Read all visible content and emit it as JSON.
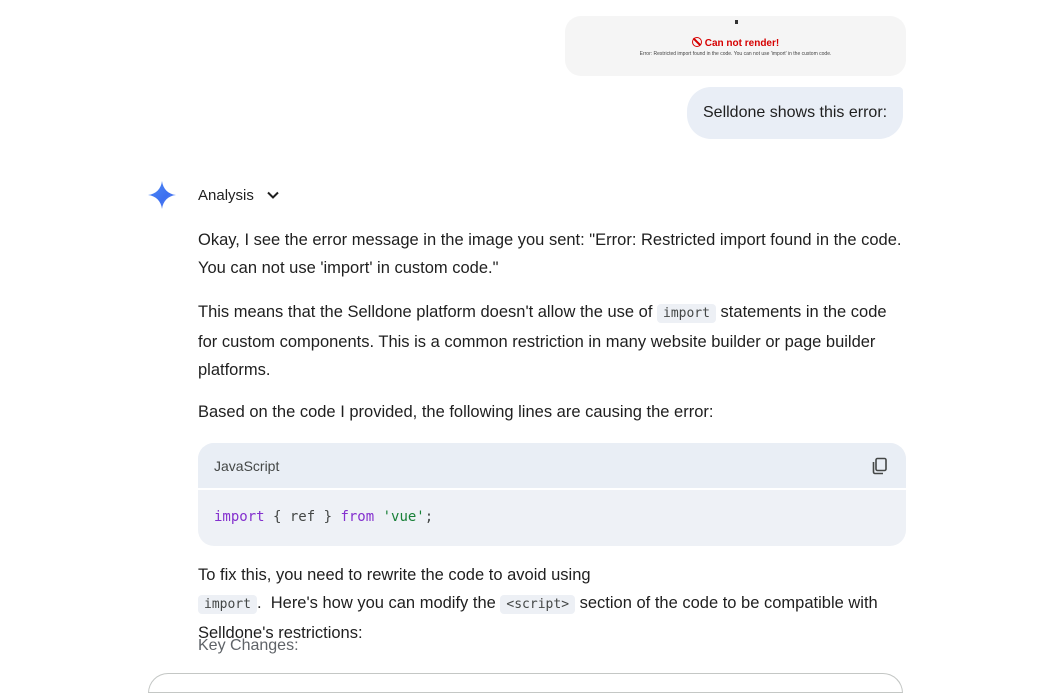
{
  "attachment": {
    "title": "Can not render!",
    "subtitle": "Error: Restricted import found in the code. You can not use 'import' in the custom code."
  },
  "user_message": "Selldone shows this error:",
  "response": {
    "analysis_label": "Analysis",
    "p1": "Okay, I see the error message in the image you sent: \"Error: Restricted import found in the code. You can not use 'import' in custom code.\"",
    "p2_before": "This means that the Selldone platform doesn't allow the use of ",
    "p2_code": "import",
    "p2_after": " statements in the code for custom components. This is a common restriction in many website builder or page builder platforms.",
    "p3": "Based on the code I provided, the following lines are causing the error:",
    "code_block": {
      "language": "JavaScript",
      "tok_import": "import",
      "tok_braces": " { ref } ",
      "tok_from": "from",
      "tok_space": " ",
      "tok_string": "'vue'",
      "tok_semi": ";"
    },
    "p4_a": "To fix this, you need to rewrite the code to avoid using ",
    "p4_code1": "import",
    "p4_b": ".  Here's how you can modify the ",
    "p4_code2": "<script>",
    "p4_c": " section of the code to be compatible with Selldone's restrictions:",
    "key_changes": "Key Changes:"
  },
  "icons": {
    "assistant": "gemini-star-icon",
    "expand": "chevron-down-icon",
    "copy": "copy-icon",
    "error": "ban-icon"
  }
}
